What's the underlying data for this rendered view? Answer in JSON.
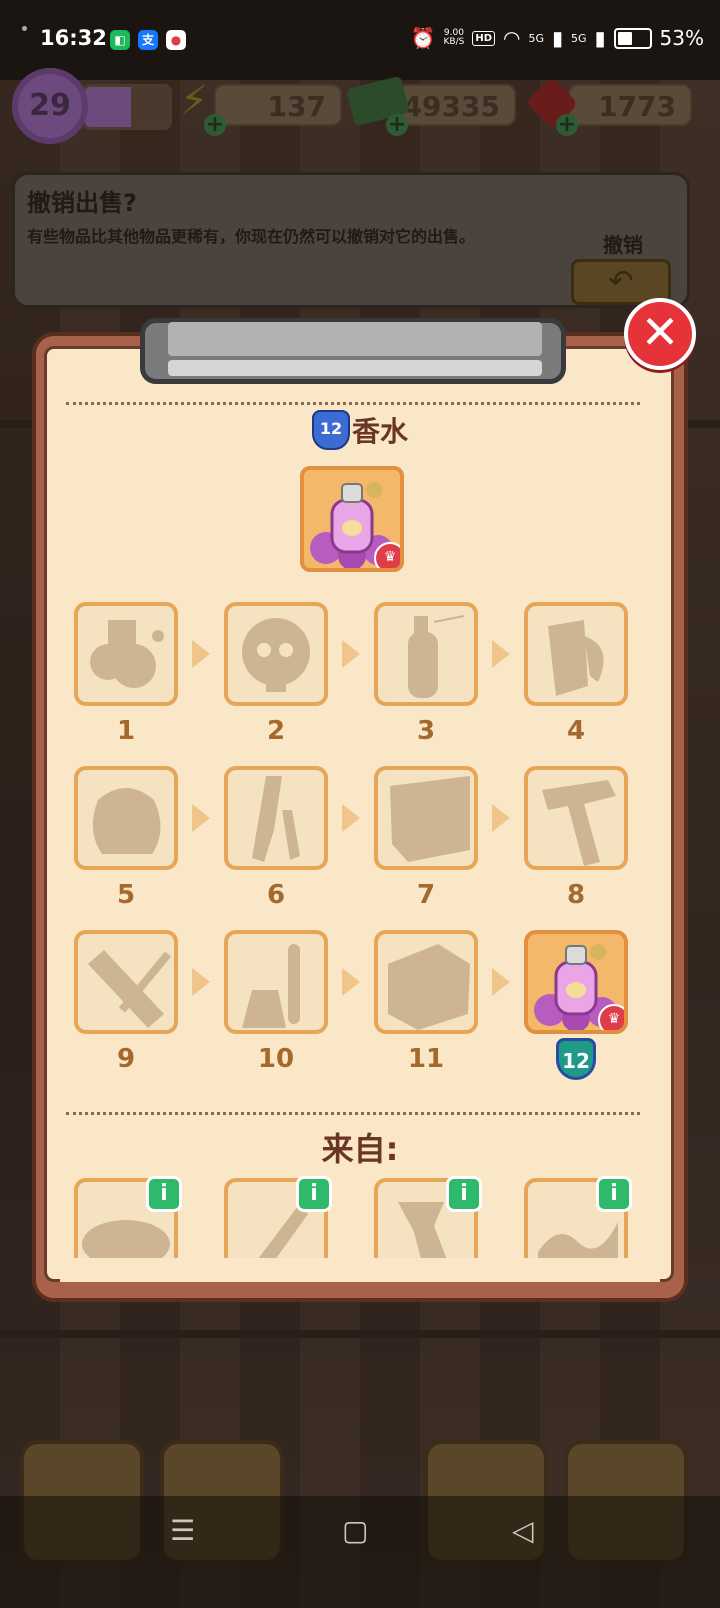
{
  "status_bar": {
    "time": "16:32",
    "net_speed_value": "9.00",
    "net_speed_unit": "KB/S",
    "hd": "HD",
    "sig1": "5G",
    "sig2": "5G",
    "battery": "53%",
    "battery_level": 0.53,
    "app_icons": [
      "message-app-icon",
      "alipay-icon",
      "map-pin-app-icon"
    ]
  },
  "resources": {
    "level": "29",
    "xp_progress": 0.55,
    "energy": "137",
    "cash": "49335",
    "gems": "1773"
  },
  "banner": {
    "title": "撤销出售?",
    "description": "有些物品比其他物品更稀有，你现在仍然可以撤销对它的出售。",
    "undo_label": "撤销"
  },
  "item": {
    "level": "12",
    "name": "香水"
  },
  "chain": [
    {
      "num": "1",
      "icon": "flowers-icon"
    },
    {
      "num": "2",
      "icon": "skull-icon"
    },
    {
      "num": "3",
      "icon": "spray-can-icon"
    },
    {
      "num": "4",
      "icon": "bottle-icon"
    },
    {
      "num": "5",
      "icon": "bag-icon"
    },
    {
      "num": "6",
      "icon": "scissors-icon"
    },
    {
      "num": "7",
      "icon": "cloth-icon"
    },
    {
      "num": "8",
      "icon": "hammer-icon"
    },
    {
      "num": "9",
      "icon": "brush-icon"
    },
    {
      "num": "10",
      "icon": "flask-icon"
    },
    {
      "num": "11",
      "icon": "box-icon"
    }
  ],
  "final_level": "12",
  "from_title": "来自:",
  "from_info_label": "i",
  "colors": {
    "accent_red": "#e53339",
    "paper": "#f9e7c8",
    "slot_border": "#e6a658",
    "number_brown": "#a5692d",
    "title_brown": "#6a3524"
  }
}
